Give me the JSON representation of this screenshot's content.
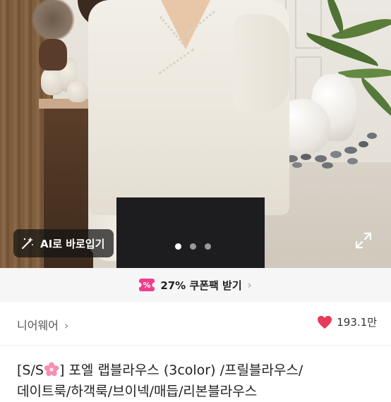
{
  "product_image": {
    "ai_button_label": "AI로 바로입기",
    "carousel_total": 3,
    "carousel_active_index": 0
  },
  "coupon_bar": {
    "label": "27% 쿠폰팩 받기",
    "accent_color": "#f03e8d"
  },
  "shop": {
    "name": "니어웨어",
    "likes": "193.1만",
    "heart_color": "#e83a5a"
  },
  "product": {
    "title_prefix": "[S/S",
    "title_rest": "] 포엘 랩블라우스 (3color) /프릴블라우스/",
    "title_line2": "데이트룩/하객룩/브이넥/매듭/리본블라우스"
  },
  "icons": [
    "magic-wand-icon",
    "expand-icon",
    "coupon-icon",
    "chevron-right-icon",
    "heart-icon",
    "cherry-blossom-icon"
  ]
}
